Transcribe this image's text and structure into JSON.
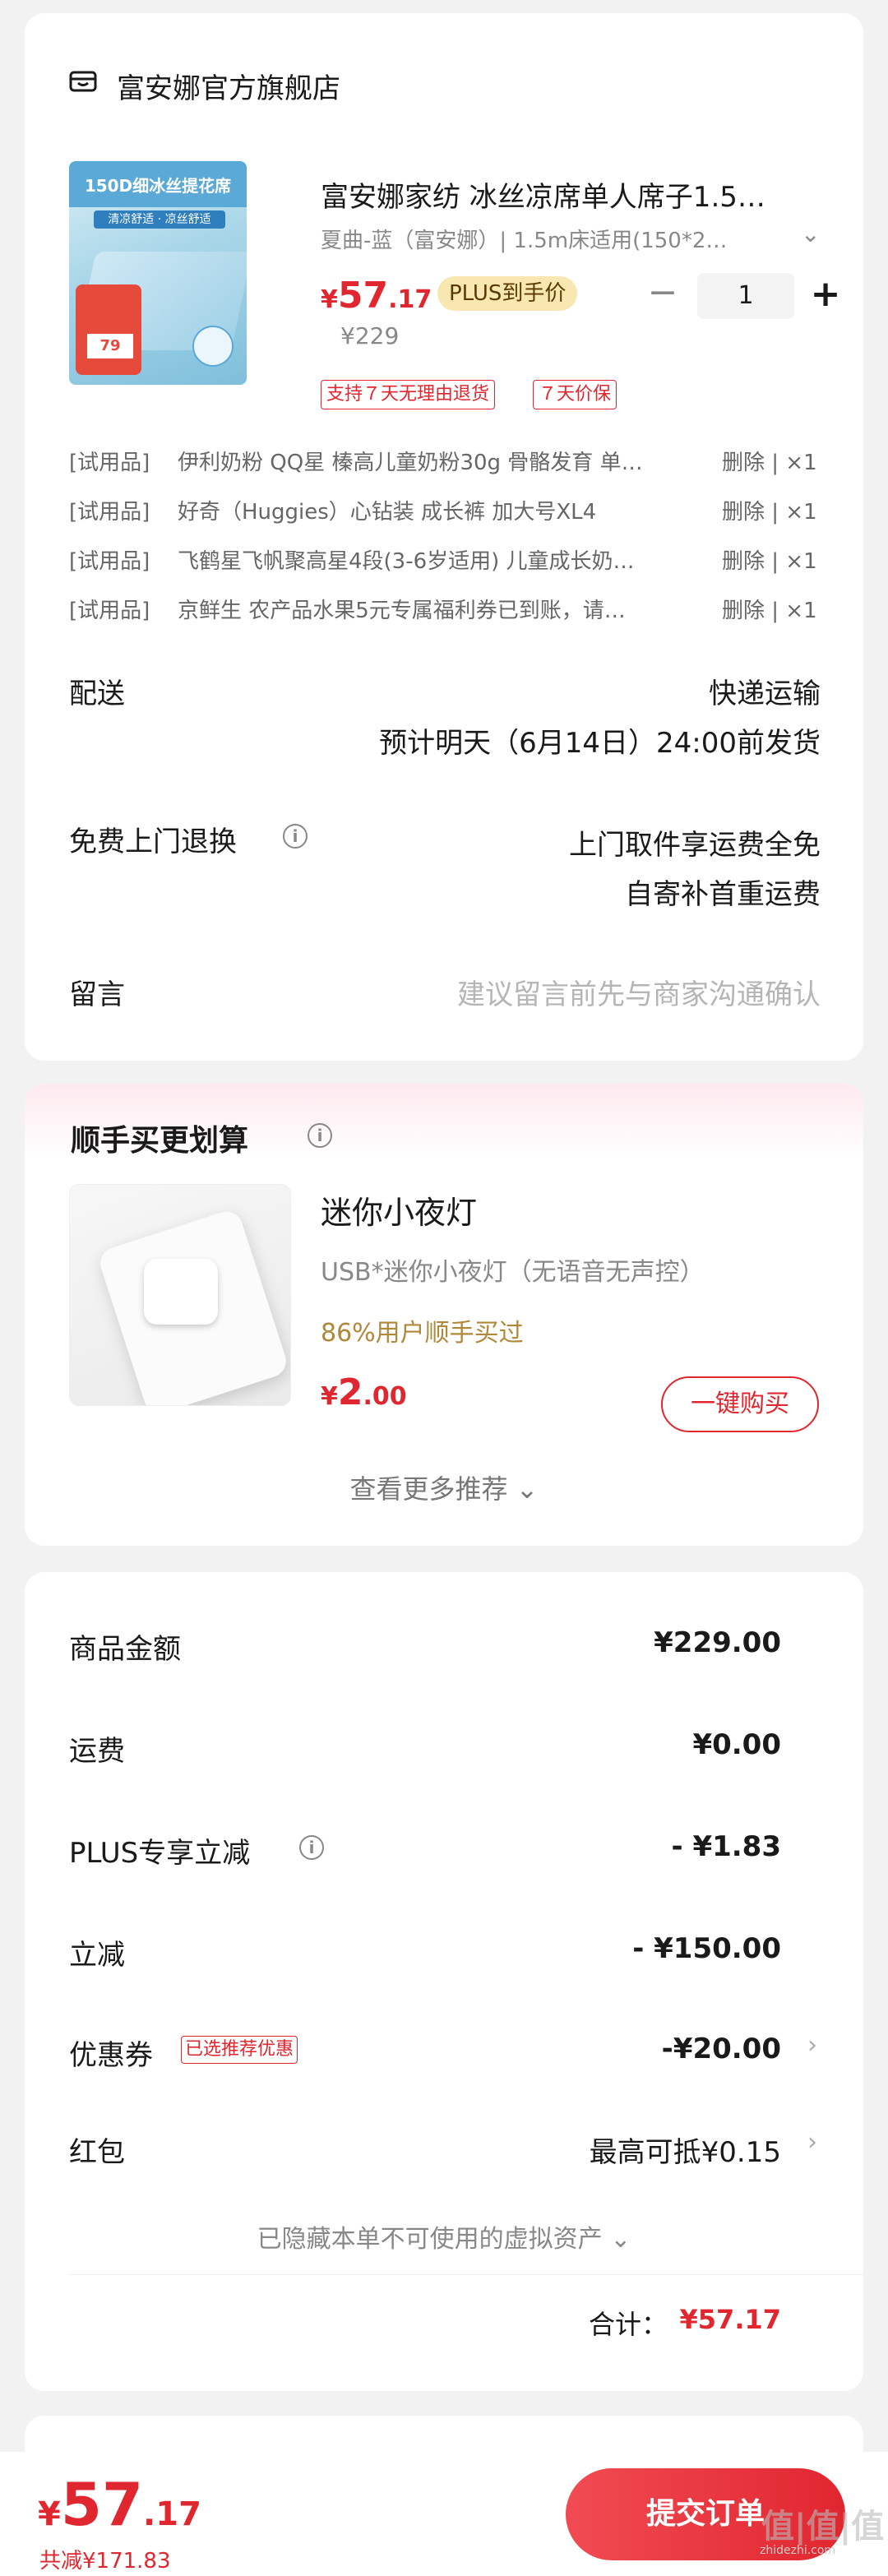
{
  "store": {
    "name": "富安娜官方旗舰店",
    "icon": "store-icon"
  },
  "product": {
    "image_banner": "150D细冰丝提花席",
    "image_sub": "清凉舒适 · 凉丝舒适",
    "image_price": "79",
    "name": "富安娜家纺 冰丝凉席单人席子1.5…",
    "spec": "夏曲-蓝（富安娜）| 1.5m床适用(150*2…",
    "price_symbol": "¥",
    "price_int": "57",
    "price_dec": ".17",
    "plus_badge": "PLUS到手价",
    "original_price": "¥229",
    "qty_minus": "−",
    "qty": "1",
    "qty_plus": "+",
    "tags": [
      "支持７天无理由退货",
      "７天价保"
    ]
  },
  "trials": [
    {
      "label": "[试用品]",
      "name": "伊利奶粉 QQ星 榛高儿童奶粉30g 骨骼发育 单…",
      "action": "删除 | ×1"
    },
    {
      "label": "[试用品]",
      "name": "好奇（Huggies）心钻装 成长裤 加大号XL4",
      "action": "删除 | ×1"
    },
    {
      "label": "[试用品]",
      "name": "飞鹤星飞帆聚高星4段(3-6岁适用) 儿童成长奶…",
      "action": "删除 | ×1"
    },
    {
      "label": "[试用品]",
      "name": "京鲜生 农产品水果5元专属福利券已到账，请…",
      "action": "删除 | ×1"
    }
  ],
  "delivery": {
    "label": "配送",
    "method": "快递运输",
    "eta": "预计明天（6月14日）24:00前发货"
  },
  "returns": {
    "label": "免费上门退换",
    "line1": "上门取件享运费全免",
    "line2": "自寄补首重运费"
  },
  "message": {
    "label": "留言",
    "placeholder": "建议留言前先与商家沟通确认"
  },
  "recommend": {
    "title": "顺手买更划算",
    "item_name": "迷你小夜灯",
    "item_desc": "USB*迷你小夜灯（无语音无声控）",
    "item_social": "86%用户顺手买过",
    "price_symbol": "¥",
    "price_int": "2",
    "price_dec": ".00",
    "buy_label": "一键购买",
    "more_label": "查看更多推荐 ⌄"
  },
  "summary": {
    "rows": [
      {
        "label": "商品金额",
        "value": "¥229.00"
      },
      {
        "label": "运费",
        "value": "¥0.00"
      },
      {
        "label": "PLUS专享立减",
        "value": "- ¥1.83"
      },
      {
        "label": "立减",
        "value": "- ¥150.00"
      },
      {
        "label": "优惠券",
        "tag": "已选推荐优惠",
        "value": "-¥20.00"
      },
      {
        "label": "红包",
        "value": "最高可抵¥0.15"
      }
    ],
    "hidden_note": "已隐藏本单不可使用的虚拟资产 ⌄",
    "total_label": "合计：",
    "total_value": "¥57.17"
  },
  "bottom": {
    "price_symbol": "¥",
    "price_int": "57",
    "price_dec": ".17",
    "saved": "共减¥171.83",
    "submit": "提交订单",
    "watermark": "值|值|值",
    "watermark_sub": "zhidezhi.com"
  },
  "colors": {
    "accent": "#e0262f",
    "plus_badge_bg": "#f8e7b0",
    "gold_text": "#b0883a"
  }
}
